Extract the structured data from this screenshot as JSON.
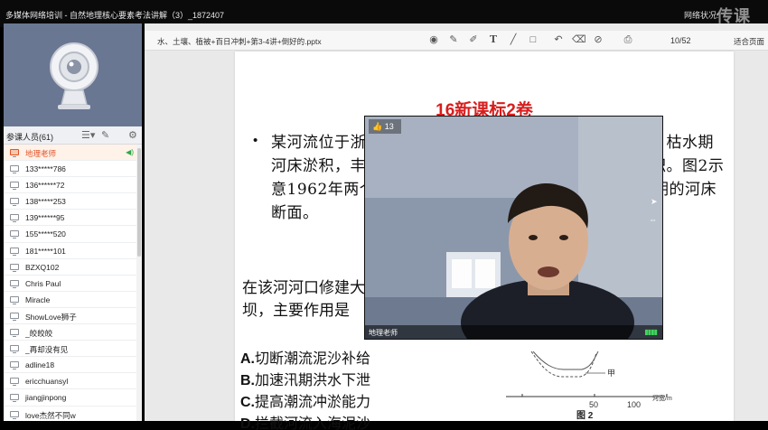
{
  "window": {
    "title": "多媒体网络培训 - 自然地理核心要素考法讲解（3）_1872407",
    "network_status": "网络状况:",
    "watermark": "传课"
  },
  "members": {
    "header_label": "参课人员(61)",
    "list": [
      {
        "name": "地理老师",
        "role": "teacher"
      },
      {
        "name": "133*****786"
      },
      {
        "name": "136******72"
      },
      {
        "name": "138*****253"
      },
      {
        "name": "139******95"
      },
      {
        "name": "155*****520"
      },
      {
        "name": "181*****101"
      },
      {
        "name": "BZXQ102"
      },
      {
        "name": "Chris Paul"
      },
      {
        "name": "Miracle"
      },
      {
        "name": "ShowLove狮子"
      },
      {
        "name": "_皎皎皎"
      },
      {
        "name": "_再却没有见"
      },
      {
        "name": "adline18"
      },
      {
        "name": "ericchuansyl"
      },
      {
        "name": "jiangjinpong"
      },
      {
        "name": "love杰然不同w"
      }
    ]
  },
  "doc": {
    "filename": "水、土壤、植被+百日冲刺+第3-4讲+倒好的.pptx",
    "page_indicator": "10/52",
    "fit_label": "适合页面",
    "tools": [
      "target-icon",
      "pen-icon",
      "marker-icon",
      "text-icon",
      "line-icon",
      "rect-icon",
      "undo-icon",
      "eraser-icon",
      "clear-icon",
      "print-icon"
    ]
  },
  "slide": {
    "title": "16新课标2卷",
    "bullet": "•",
    "question": "某河流位于浙江东部，下游河床受径流与潮汐共同影响：枯水期河床淤积，丰水期河床冲刷，上游下泄的泥沙在下游堆积。图2示意1962年两个时期河流下游某段河床断面与1962年时期的河床断面。",
    "ask": "在该河河口修建大坝，主要作用是",
    "options": [
      {
        "letter": "A.",
        "text": "切断潮流泥沙补给"
      },
      {
        "letter": "B.",
        "text": "加速汛期洪水下泄"
      },
      {
        "letter": "C.",
        "text": "提高潮流冲淤能力"
      },
      {
        "letter": "D.",
        "text": "拦截河流入海泥沙"
      }
    ],
    "figure": {
      "series_label": "甲",
      "tick_50": "50",
      "tick_100": "100",
      "axis_label": "河宽/m",
      "caption": "图 2"
    }
  },
  "video": {
    "like_count": "13",
    "speaker": "地理老师",
    "level": "▮▮▮▮"
  },
  "colors": {
    "accent_title": "#d81e1e",
    "teacher_highlight": "#e0532a",
    "member_panel_top": "#6a7793"
  }
}
